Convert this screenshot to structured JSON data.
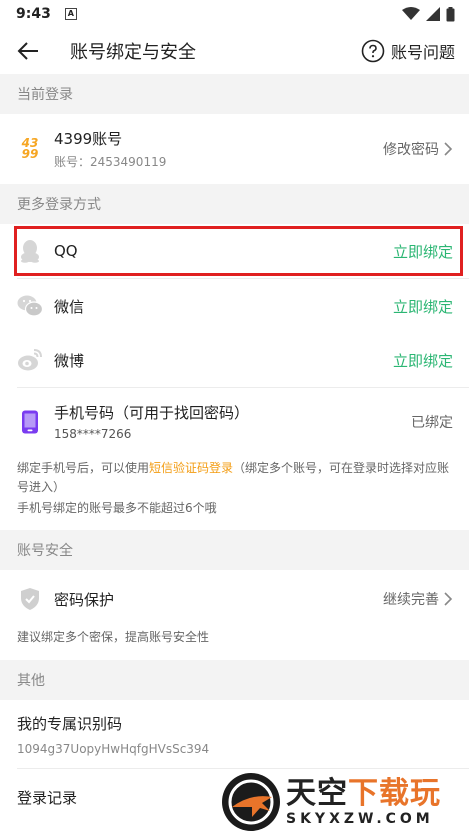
{
  "status": {
    "time": "9:43",
    "badge": "A"
  },
  "header": {
    "title": "账号绑定与安全",
    "help_label": "账号问题"
  },
  "current_login": {
    "section_label": "当前登录",
    "logo_text_top": "43",
    "logo_text_bottom": "99",
    "account_type": "4399账号",
    "account_id": "账号：2453490119",
    "action": "修改密码"
  },
  "more_login": {
    "section_label": "更多登录方式",
    "items": [
      {
        "label": "QQ",
        "action": "立即绑定"
      },
      {
        "label": "微信",
        "action": "立即绑定"
      },
      {
        "label": "微博",
        "action": "立即绑定"
      }
    ],
    "phone": {
      "label": "手机号码（可用于找回密码）",
      "number": "158****7266",
      "status": "已绑定"
    },
    "note_prefix": "绑定手机号后，可以使用",
    "note_highlight": "短信验证码登录",
    "note_suffix": "（绑定多个账号，可在登录时选择对应账号进入）",
    "note_line2": "手机号绑定的账号最多不能超过6个哦"
  },
  "security": {
    "section_label": "账号安全",
    "item_label": "密码保护",
    "item_action": "继续完善",
    "note": "建议绑定多个密保，提高账号安全性"
  },
  "other": {
    "section_label": "其他",
    "code_label": "我的专属识别码",
    "code_value": "1094g37UopyHwHqfgHVsSc394",
    "record_label": "登录记录"
  },
  "watermark": {
    "big1": "天空",
    "big2": "下载玩",
    "url": "SKYXZW.COM"
  },
  "colors": {
    "green": "#2bb673",
    "orange": "#f39c12",
    "red_box": "#e02020",
    "purple_phone": "#7a3cf0"
  }
}
